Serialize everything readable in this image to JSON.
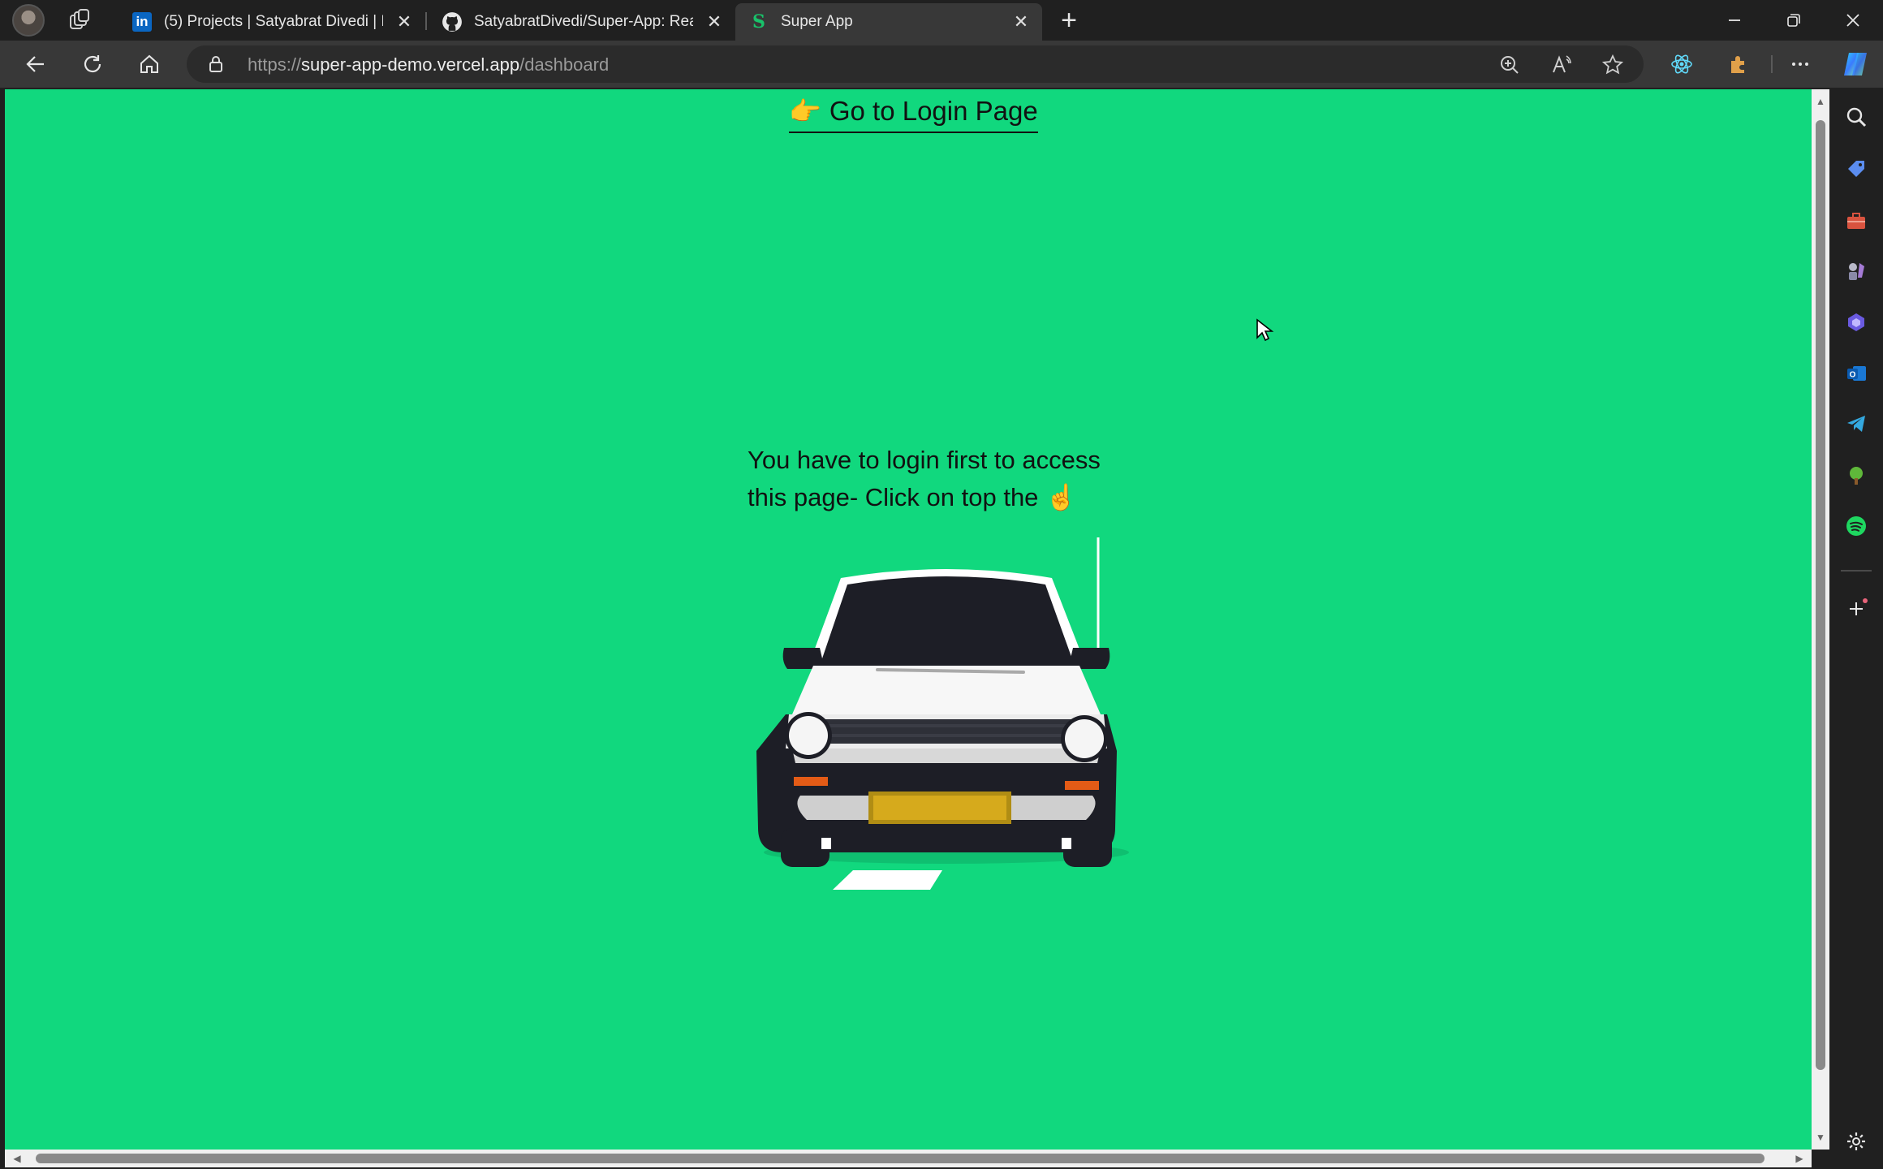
{
  "browser": {
    "tabs": [
      {
        "label": "(5) Projects | Satyabrat Divedi | Li",
        "icon": "linkedin-icon",
        "active": false
      },
      {
        "label": "SatyabratDivedi/Super-App: Reac",
        "icon": "github-icon",
        "active": false
      },
      {
        "label": "Super App",
        "icon": "site-favicon-icon",
        "active": true
      }
    ],
    "favicon_letter": "S",
    "linkedin_letters": "in",
    "address": {
      "scheme": "https://",
      "host": "super-app-demo.vercel.app",
      "path": "/dashboard"
    }
  },
  "page": {
    "login_emoji": "👉",
    "login_link": "Go to Login Page",
    "message": "You have to login first to access this page- Click on top the ☝️",
    "background_color": "#11d87e"
  },
  "sidebar": {
    "icons": [
      "search-icon",
      "tag-icon",
      "toolbox-icon",
      "games-icon",
      "copilot-icon",
      "outlook-icon",
      "telegram-icon",
      "tree-icon",
      "spotify-icon",
      "add-icon",
      "settings-icon"
    ]
  }
}
